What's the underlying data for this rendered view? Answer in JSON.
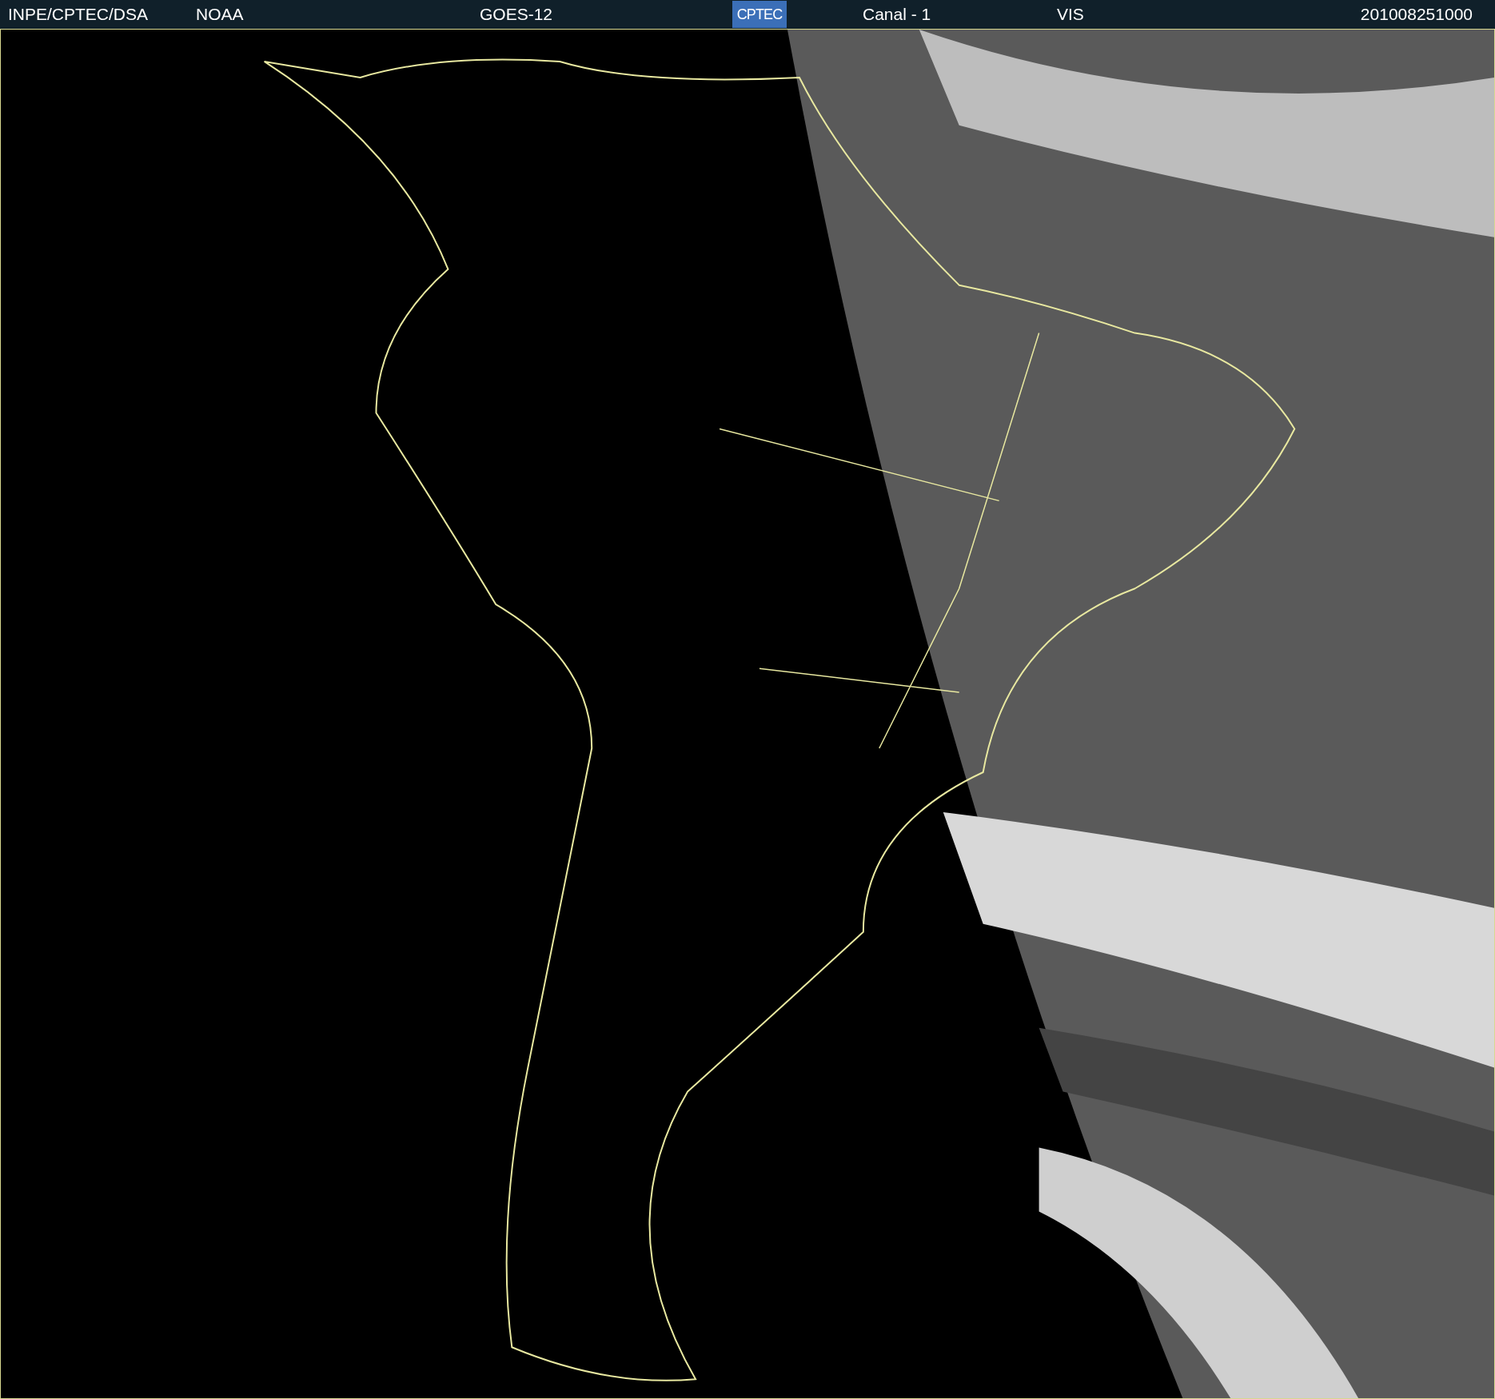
{
  "header": {
    "source": "INPE/CPTEC/DSA",
    "agency": "NOAA",
    "satellite": "GOES-12",
    "logo": "CPTEC",
    "channel": "Canal - 1",
    "band": "VIS",
    "timestamp": "201008251000"
  }
}
